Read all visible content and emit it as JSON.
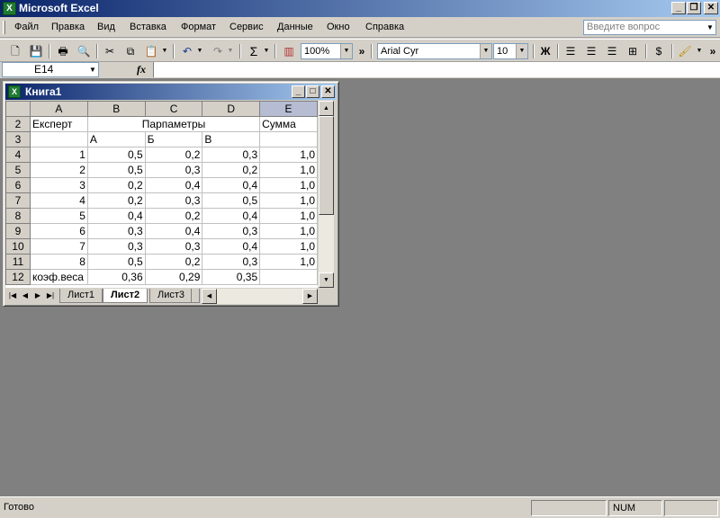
{
  "app": {
    "title": "Microsoft Excel",
    "icon_text": "X"
  },
  "menu": [
    {
      "label": "Файл"
    },
    {
      "label": "Правка"
    },
    {
      "label": "Вид"
    },
    {
      "label": "Вставка"
    },
    {
      "label": "Формат"
    },
    {
      "label": "Сервис"
    },
    {
      "label": "Данные"
    },
    {
      "label": "Окно"
    },
    {
      "label": "Справка"
    }
  ],
  "ask_box": {
    "placeholder": "Введите вопрос"
  },
  "toolbar": {
    "sum_glyph": "Σ",
    "zoom": "100%",
    "font_name": "Arial Cyr",
    "font_size": "10",
    "bold_glyph": "Ж",
    "more_glyph": "»"
  },
  "formula_bar": {
    "name_box": "E14",
    "fx_label": "fx",
    "formula": ""
  },
  "workbook": {
    "title": "Книга1",
    "icon_text": "X",
    "columns": [
      "A",
      "B",
      "C",
      "D",
      "E"
    ],
    "selected_column": "E",
    "rows": [
      {
        "num": "2",
        "cells": [
          "Експерт",
          "",
          "Парпаметры",
          "",
          "Сумма"
        ]
      },
      {
        "num": "3",
        "cells": [
          "",
          "А",
          "Б",
          "В",
          ""
        ]
      },
      {
        "num": "4",
        "cells": [
          "1",
          "0,5",
          "0,2",
          "0,3",
          "1,0"
        ]
      },
      {
        "num": "5",
        "cells": [
          "2",
          "0,5",
          "0,3",
          "0,2",
          "1,0"
        ]
      },
      {
        "num": "6",
        "cells": [
          "3",
          "0,2",
          "0,4",
          "0,4",
          "1,0"
        ]
      },
      {
        "num": "7",
        "cells": [
          "4",
          "0,2",
          "0,3",
          "0,5",
          "1,0"
        ]
      },
      {
        "num": "8",
        "cells": [
          "5",
          "0,4",
          "0,2",
          "0,4",
          "1,0"
        ]
      },
      {
        "num": "9",
        "cells": [
          "6",
          "0,3",
          "0,4",
          "0,3",
          "1,0"
        ]
      },
      {
        "num": "10",
        "cells": [
          "7",
          "0,3",
          "0,3",
          "0,4",
          "1,0"
        ]
      },
      {
        "num": "11",
        "cells": [
          "8",
          "0,5",
          "0,2",
          "0,3",
          "1,0"
        ]
      },
      {
        "num": "12",
        "cells": [
          "коэф.веса",
          "0,36",
          "0,29",
          "0,35",
          ""
        ]
      }
    ],
    "sheets": [
      {
        "label": "Лист1",
        "active": false
      },
      {
        "label": "Лист2",
        "active": true
      },
      {
        "label": "Лист3",
        "active": false
      }
    ]
  },
  "status": {
    "text": "Готово",
    "num": "NUM"
  }
}
